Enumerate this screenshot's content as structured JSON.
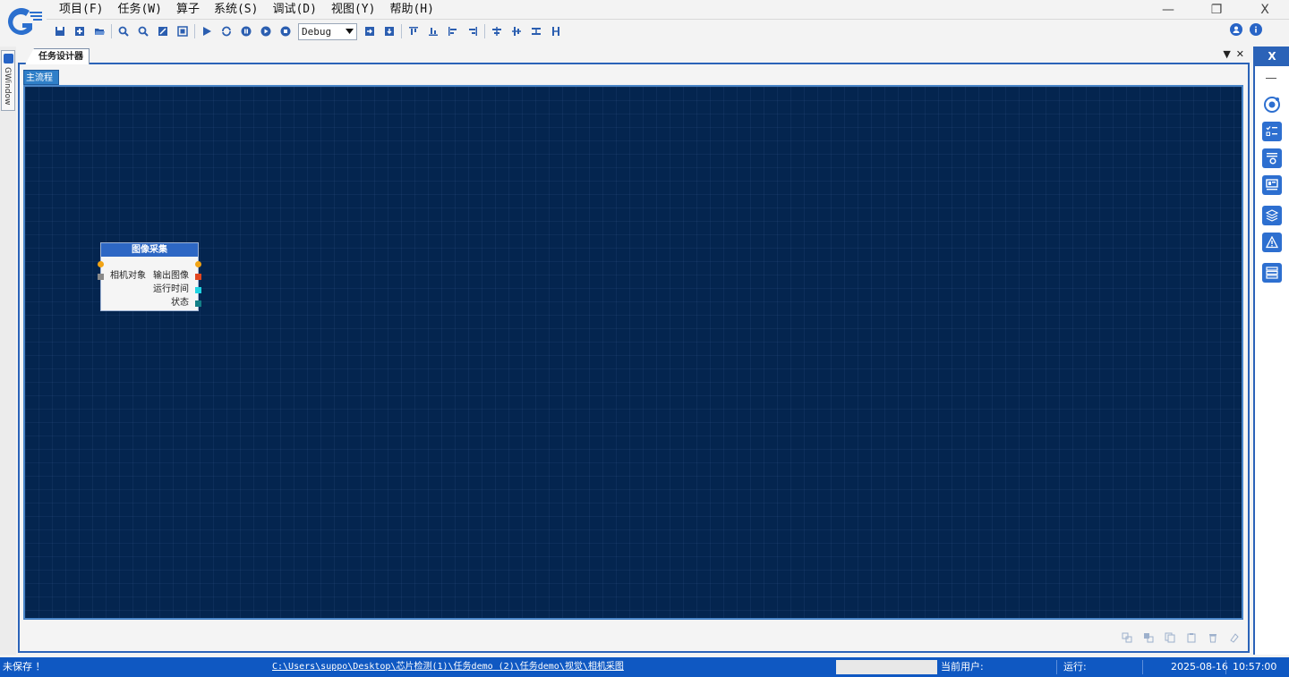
{
  "menu": {
    "items": [
      "项目(F)",
      "任务(W)",
      "算子",
      "系统(S)",
      "调试(D)",
      "视图(Y)",
      "帮助(H)"
    ]
  },
  "window_controls": {
    "minimize": "—",
    "restore": "❐",
    "close": "X"
  },
  "toolbar": {
    "mode_select": "Debug"
  },
  "left_panel": {
    "tab_label": "GWindow"
  },
  "document": {
    "tab_label": "任务设计器",
    "dropdown_glyph": "▼",
    "close_glyph": "✕",
    "flow_tab": "主流程"
  },
  "node": {
    "title": "图像采集",
    "input_label": "相机对象",
    "outputs": [
      "输出图像",
      "运行时间",
      "状态"
    ]
  },
  "right_dock": {
    "close_label": "X"
  },
  "statusbar": {
    "save_state": "未保存 ！",
    "path": "C:\\Users\\suppo\\Desktop\\芯片检测(1)\\任务demo (2)\\任务demo\\视觉\\相机采图",
    "user_label": "当前用户:",
    "run_label": "运行:",
    "date": "2025-08-16",
    "time": "10:57:00"
  },
  "colors": {
    "accent": "#2b63b8",
    "canvas_bg": "#04254f",
    "statusbar": "#0f58c2",
    "port_output_image": "#e2461f",
    "port_runtime": "#1fd3e2",
    "port_status": "#137f86",
    "port_trigger": "#f2a416",
    "port_input": "#8a8a8a"
  }
}
